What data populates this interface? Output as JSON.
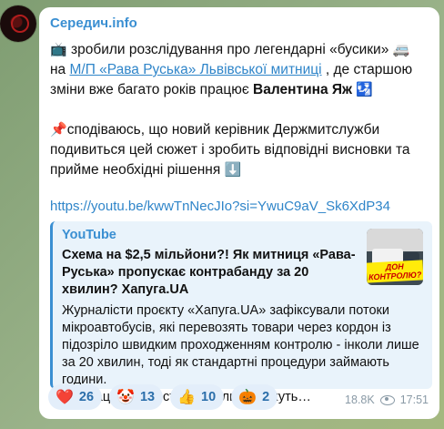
{
  "channel": {
    "name": "Середич.info"
  },
  "message": {
    "p1": {
      "emoji_tv": "📺",
      "t1": " зробили розслідування про легендарні «бусики» ",
      "emoji_van": "🚐",
      "t2": " на ",
      "link": "М/П «Рава Руська» Львівської митниці",
      "t3": " , де старшою зміни вже багато років працює ",
      "name": "Валентина Яж",
      "emoji_end": " 🛂"
    },
    "p2": {
      "emoji_pin": "📌",
      "t1": "сподіваюсь, що новий керівник Держмитслужби подивиться цей сюжет і зробить відповідні висновки та прийме необхідні рішення ",
      "emoji_down": "⬇️"
    },
    "url": "https://youtu.be/kwwTnNecJIo?si=YwuC9aV_Sk6XdP34"
  },
  "preview": {
    "site": "YouTube",
    "title": "Схема на $2,5 мільйони?! Як митниця «Рава-Руська» пропускає контрабанду за 20 хвилин? Хапуга.UA",
    "description": "Журналісти проєкту «Хапуга.UA» зафіксували потоки мікроавтобусів, які перевозять товари через кордон із підозріло швидким проходженням контролю - інколи лише за 20 хвилин, тоді як стандартні процедури займають години.\nЯк працює ця система, скільки можуть…",
    "thumb_text": "ДОН КОНТРОЛЮ?"
  },
  "reactions": [
    {
      "emoji": "❤️",
      "count": "26"
    },
    {
      "emoji": "🤡",
      "count": "13"
    },
    {
      "emoji": "👍",
      "count": "10"
    },
    {
      "emoji": "🎃",
      "count": "2"
    }
  ],
  "meta": {
    "views": "18.8K",
    "time": "17:51"
  }
}
